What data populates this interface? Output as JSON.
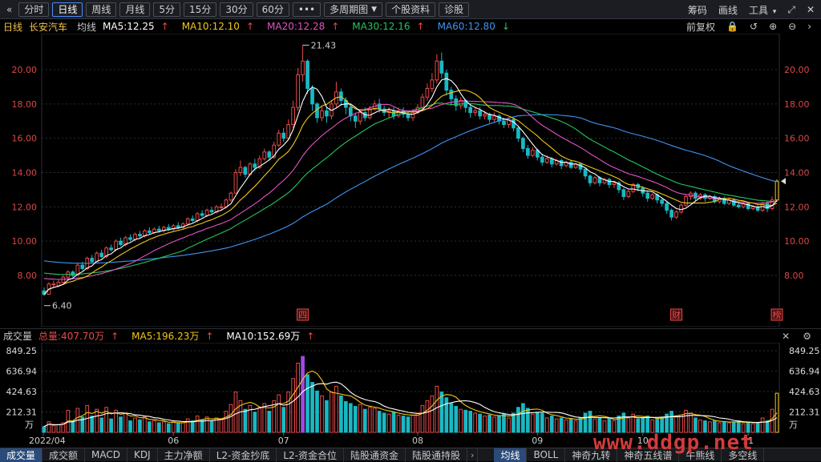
{
  "toolbar": {
    "back_icon": "double-left-arrow",
    "periods": [
      "分时",
      "日线",
      "周线",
      "月线",
      "5分",
      "15分",
      "30分",
      "60分"
    ],
    "active_period": "日线",
    "more_label": "•••",
    "multi_period_label": "多周期图",
    "profile_label": "个股资料",
    "diagnose_label": "诊股",
    "right_items": [
      "筹码",
      "画线",
      "工具"
    ],
    "tools_caret": "▾"
  },
  "ma_bar": {
    "period_label": "日线",
    "stock_name": "长安汽车",
    "avg_label": "均线",
    "ma5": "MA5:12.25",
    "ma10": "MA10:12.10",
    "ma20": "MA20:12.28",
    "ma30": "MA30:12.16",
    "ma60": "MA60:12.80",
    "arrow_up": "↑",
    "arrow_down": "↓",
    "adjust_label": "前复权"
  },
  "vol_bar": {
    "label": "成交量",
    "total": "总量:407.70万",
    "ma5": "MA5:196.23万",
    "ma10": "MA10:152.69万",
    "arrow_up": "↑"
  },
  "colors": {
    "up": "#e84a4a",
    "down": "#19b9c4",
    "ma5": "#ffffff",
    "ma10": "#f2c618",
    "ma20": "#e352c4",
    "ma30": "#26c45f",
    "ma60": "#3c96f0",
    "highlight": "#a04ae6",
    "grid": "#2c2e33",
    "axis_text": "#d84848",
    "accent": "#4a8cff"
  },
  "chart_data": {
    "type": "candlestick",
    "price_axis": {
      "ticks": [
        "20.00",
        "18.00",
        "16.00",
        "14.00",
        "12.00",
        "10.00",
        "8.00"
      ],
      "ylim": [
        6.4,
        21.43
      ]
    },
    "volume_axis": {
      "ticks": [
        "849.25",
        "636.94",
        "424.63",
        "212.31"
      ],
      "unit": "万"
    },
    "x_labels": [
      "2022/04",
      "06",
      "07",
      "08",
      "09",
      "10",
      "11"
    ],
    "annotations": {
      "high": "21.43",
      "low": "6.40",
      "markers": [
        "四",
        "财",
        "榜"
      ]
    },
    "candles": [
      [
        7.1,
        6.9,
        7.3,
        6.8,
        60
      ],
      [
        6.9,
        7.5,
        7.6,
        6.9,
        110
      ],
      [
        7.5,
        7.5,
        7.7,
        7.3,
        70
      ],
      [
        7.4,
        7.6,
        7.8,
        7.3,
        80
      ],
      [
        7.6,
        7.9,
        8.0,
        7.5,
        100
      ],
      [
        7.9,
        8.2,
        8.3,
        7.8,
        230
      ],
      [
        8.2,
        8.0,
        8.3,
        7.9,
        120
      ],
      [
        8.0,
        8.6,
        8.7,
        8.0,
        250
      ],
      [
        8.6,
        8.4,
        8.8,
        8.3,
        160
      ],
      [
        8.4,
        9.0,
        9.1,
        8.3,
        280
      ],
      [
        9.0,
        8.8,
        9.2,
        8.7,
        170
      ],
      [
        8.8,
        9.3,
        9.4,
        8.8,
        240
      ],
      [
        9.3,
        9.1,
        9.5,
        9.0,
        150
      ],
      [
        9.1,
        9.6,
        9.7,
        9.0,
        260
      ],
      [
        9.6,
        9.5,
        9.8,
        9.4,
        140
      ],
      [
        9.5,
        10.0,
        10.1,
        9.4,
        230
      ],
      [
        10.0,
        9.8,
        10.2,
        9.7,
        160
      ],
      [
        9.8,
        10.2,
        10.3,
        9.7,
        200
      ],
      [
        10.2,
        10.1,
        10.4,
        10.0,
        120
      ],
      [
        10.1,
        10.4,
        10.5,
        10.0,
        150
      ],
      [
        10.4,
        10.3,
        10.6,
        10.2,
        130
      ],
      [
        10.3,
        10.6,
        10.7,
        10.2,
        160
      ],
      [
        10.6,
        10.5,
        10.8,
        10.4,
        110
      ],
      [
        10.5,
        10.7,
        10.8,
        10.4,
        120
      ],
      [
        10.7,
        10.6,
        10.9,
        10.5,
        100
      ],
      [
        10.6,
        10.8,
        10.9,
        10.5,
        110
      ],
      [
        10.8,
        10.7,
        11.0,
        10.6,
        90
      ],
      [
        10.7,
        10.9,
        11.0,
        10.6,
        110
      ],
      [
        10.9,
        10.8,
        11.1,
        10.7,
        95
      ],
      [
        10.8,
        11.0,
        11.1,
        10.7,
        100
      ],
      [
        11.0,
        11.3,
        11.4,
        10.9,
        140
      ],
      [
        11.3,
        11.2,
        11.5,
        11.1,
        120
      ],
      [
        11.2,
        11.6,
        11.7,
        11.1,
        170
      ],
      [
        11.6,
        11.5,
        11.8,
        11.4,
        130
      ],
      [
        11.5,
        11.8,
        11.9,
        11.4,
        160
      ],
      [
        11.8,
        11.7,
        12.0,
        11.6,
        120
      ],
      [
        11.7,
        12.0,
        12.1,
        11.6,
        150
      ],
      [
        12.0,
        12.0,
        12.2,
        11.8,
        140
      ],
      [
        12.0,
        12.4,
        12.5,
        11.9,
        220
      ],
      [
        12.4,
        12.8,
        12.9,
        12.3,
        290
      ],
      [
        12.8,
        14.0,
        14.2,
        12.8,
        420
      ],
      [
        14.0,
        14.3,
        14.7,
        13.8,
        330
      ],
      [
        14.3,
        13.9,
        14.4,
        13.7,
        240
      ],
      [
        13.9,
        14.5,
        14.6,
        13.8,
        280
      ],
      [
        14.5,
        14.3,
        14.8,
        14.1,
        210
      ],
      [
        14.3,
        14.8,
        15.0,
        14.2,
        260
      ],
      [
        14.8,
        15.2,
        15.4,
        14.7,
        300
      ],
      [
        15.2,
        14.9,
        15.3,
        14.7,
        220
      ],
      [
        14.9,
        15.6,
        15.8,
        14.8,
        330
      ],
      [
        15.6,
        16.3,
        16.5,
        15.5,
        390
      ],
      [
        16.3,
        16.0,
        16.6,
        15.8,
        260
      ],
      [
        16.0,
        16.8,
        17.1,
        15.9,
        420
      ],
      [
        16.8,
        17.8,
        18.2,
        16.6,
        560
      ],
      [
        17.8,
        19.7,
        20.1,
        17.6,
        720
      ],
      [
        19.7,
        20.5,
        21.43,
        19.3,
        790
      ],
      [
        20.5,
        18.9,
        20.6,
        18.6,
        600
      ],
      [
        18.9,
        18.0,
        19.1,
        17.6,
        520
      ],
      [
        18.0,
        17.2,
        18.1,
        16.9,
        430
      ],
      [
        17.2,
        17.6,
        17.9,
        17.0,
        380
      ],
      [
        17.6,
        17.3,
        17.8,
        16.9,
        330
      ],
      [
        17.3,
        18.0,
        18.2,
        17.1,
        420
      ],
      [
        18.0,
        18.7,
        19.3,
        17.8,
        480
      ],
      [
        18.7,
        18.2,
        18.9,
        17.9,
        380
      ],
      [
        18.2,
        17.8,
        18.4,
        17.4,
        320
      ],
      [
        17.8,
        17.3,
        18.0,
        17.0,
        300
      ],
      [
        17.3,
        17.0,
        17.5,
        16.6,
        270
      ],
      [
        17.0,
        17.5,
        17.7,
        16.8,
        290
      ],
      [
        17.5,
        17.2,
        17.8,
        17.0,
        240
      ],
      [
        17.2,
        17.7,
        17.9,
        17.1,
        260
      ],
      [
        17.7,
        18.0,
        18.2,
        17.6,
        250
      ],
      [
        18.0,
        17.7,
        18.3,
        17.5,
        220
      ],
      [
        17.7,
        17.5,
        17.9,
        17.3,
        200
      ],
      [
        17.5,
        17.6,
        17.8,
        17.2,
        190
      ],
      [
        17.6,
        17.3,
        17.8,
        17.1,
        210
      ],
      [
        17.3,
        17.6,
        17.8,
        17.2,
        180
      ],
      [
        17.6,
        17.4,
        17.8,
        17.2,
        170
      ],
      [
        17.4,
        17.2,
        17.6,
        17.0,
        160
      ],
      [
        17.2,
        17.5,
        17.7,
        17.0,
        180
      ],
      [
        17.5,
        17.8,
        18.0,
        17.4,
        200
      ],
      [
        17.8,
        18.4,
        18.6,
        17.7,
        280
      ],
      [
        18.4,
        18.9,
        19.2,
        18.2,
        330
      ],
      [
        18.9,
        19.4,
        19.8,
        18.7,
        380
      ],
      [
        19.4,
        20.5,
        20.9,
        19.2,
        480
      ],
      [
        20.5,
        19.8,
        21.0,
        19.5,
        420
      ],
      [
        19.8,
        18.8,
        20.0,
        18.5,
        360
      ],
      [
        18.8,
        18.3,
        19.0,
        17.9,
        300
      ],
      [
        18.3,
        17.9,
        18.5,
        17.6,
        270
      ],
      [
        17.9,
        18.2,
        18.4,
        17.7,
        240
      ],
      [
        18.2,
        17.8,
        18.3,
        17.5,
        230
      ],
      [
        17.8,
        17.5,
        18.0,
        17.2,
        220
      ],
      [
        17.5,
        17.6,
        17.8,
        17.3,
        200
      ],
      [
        17.6,
        17.3,
        17.8,
        17.1,
        190
      ],
      [
        17.3,
        17.4,
        17.6,
        17.1,
        170
      ],
      [
        17.4,
        17.1,
        17.5,
        16.9,
        180
      ],
      [
        17.1,
        17.3,
        17.5,
        16.9,
        160
      ],
      [
        17.3,
        17.0,
        17.4,
        16.8,
        170
      ],
      [
        17.0,
        16.8,
        17.2,
        16.6,
        190
      ],
      [
        16.8,
        17.1,
        17.2,
        16.6,
        150
      ],
      [
        17.1,
        16.6,
        17.2,
        16.4,
        200
      ],
      [
        16.6,
        16.0,
        16.7,
        15.8,
        260
      ],
      [
        16.0,
        15.4,
        16.1,
        15.2,
        300
      ],
      [
        15.4,
        15.0,
        15.6,
        14.8,
        250
      ],
      [
        15.0,
        15.3,
        15.5,
        14.9,
        190
      ],
      [
        15.3,
        14.9,
        15.4,
        14.7,
        210
      ],
      [
        14.9,
        14.6,
        15.1,
        14.4,
        200
      ],
      [
        14.6,
        14.8,
        15.0,
        14.5,
        150
      ],
      [
        14.8,
        14.5,
        14.9,
        14.3,
        170
      ],
      [
        14.5,
        14.7,
        14.8,
        14.4,
        140
      ],
      [
        14.7,
        14.4,
        14.8,
        14.2,
        150
      ],
      [
        14.4,
        14.6,
        14.7,
        14.3,
        130
      ],
      [
        14.6,
        14.3,
        14.7,
        14.2,
        140
      ],
      [
        14.3,
        14.5,
        14.6,
        14.2,
        120
      ],
      [
        14.5,
        14.2,
        14.6,
        14.0,
        150
      ],
      [
        14.2,
        13.8,
        14.3,
        13.6,
        200
      ],
      [
        13.8,
        13.4,
        13.9,
        13.2,
        220
      ],
      [
        13.4,
        13.7,
        13.8,
        13.3,
        140
      ],
      [
        13.7,
        13.4,
        13.8,
        13.2,
        150
      ],
      [
        13.4,
        13.6,
        13.7,
        13.3,
        120
      ],
      [
        13.6,
        13.3,
        13.7,
        13.1,
        140
      ],
      [
        13.3,
        13.4,
        13.5,
        13.1,
        120
      ],
      [
        13.4,
        13.0,
        13.5,
        12.8,
        170
      ],
      [
        13.0,
        12.6,
        13.1,
        12.4,
        200
      ],
      [
        12.6,
        12.9,
        13.0,
        12.5,
        150
      ],
      [
        12.9,
        13.3,
        13.4,
        12.8,
        190
      ],
      [
        13.3,
        13.1,
        13.4,
        12.9,
        140
      ],
      [
        13.1,
        12.8,
        13.2,
        12.6,
        150
      ],
      [
        12.8,
        12.5,
        12.9,
        12.3,
        170
      ],
      [
        12.5,
        12.7,
        12.8,
        12.4,
        130
      ],
      [
        12.7,
        12.4,
        12.8,
        12.2,
        140
      ],
      [
        12.4,
        12.2,
        12.5,
        12.0,
        150
      ],
      [
        12.2,
        11.8,
        12.3,
        11.6,
        190
      ],
      [
        11.8,
        11.4,
        11.9,
        11.2,
        220
      ],
      [
        11.4,
        11.7,
        11.8,
        11.3,
        160
      ],
      [
        11.7,
        12.1,
        12.2,
        11.6,
        180
      ],
      [
        12.1,
        12.6,
        12.7,
        12.0,
        230
      ],
      [
        12.6,
        12.8,
        12.9,
        12.4,
        200
      ],
      [
        12.8,
        12.5,
        12.9,
        12.3,
        150
      ],
      [
        12.5,
        12.7,
        12.8,
        12.4,
        130
      ],
      [
        12.7,
        12.5,
        12.8,
        12.3,
        120
      ],
      [
        12.5,
        12.6,
        12.7,
        12.4,
        110
      ],
      [
        12.6,
        12.3,
        12.7,
        12.2,
        120
      ],
      [
        12.3,
        12.5,
        12.6,
        12.2,
        100
      ],
      [
        12.5,
        12.2,
        12.6,
        12.1,
        110
      ],
      [
        12.2,
        12.4,
        12.5,
        12.1,
        100
      ],
      [
        12.4,
        12.1,
        12.5,
        12.0,
        110
      ],
      [
        12.1,
        12.0,
        12.2,
        11.9,
        120
      ],
      [
        12.0,
        12.2,
        12.3,
        11.9,
        90
      ],
      [
        12.2,
        11.9,
        12.3,
        11.8,
        100
      ],
      [
        11.9,
        12.0,
        12.1,
        11.8,
        90
      ],
      [
        12.0,
        11.8,
        12.1,
        11.7,
        100
      ],
      [
        11.8,
        12.2,
        12.3,
        11.7,
        150
      ],
      [
        12.2,
        11.9,
        12.3,
        11.7,
        120
      ],
      [
        11.9,
        12.4,
        12.6,
        11.8,
        240
      ],
      [
        12.4,
        13.5,
        13.6,
        12.3,
        407
      ]
    ]
  },
  "bottom_tabs": {
    "left": [
      "成交量",
      "成交额",
      "MACD",
      "KDJ",
      "主力净额",
      "L2-资金抄底",
      "L2-资金合位",
      "陆股通资金",
      "陆股通持股"
    ],
    "active_left": "成交量",
    "arrow": "›",
    "right": [
      "均线",
      "BOLL",
      "神奇九转",
      "神奇五线谱",
      "牛熊线",
      "多空线"
    ],
    "active_right": "均线",
    "watermark": "www.ddgp.net"
  }
}
